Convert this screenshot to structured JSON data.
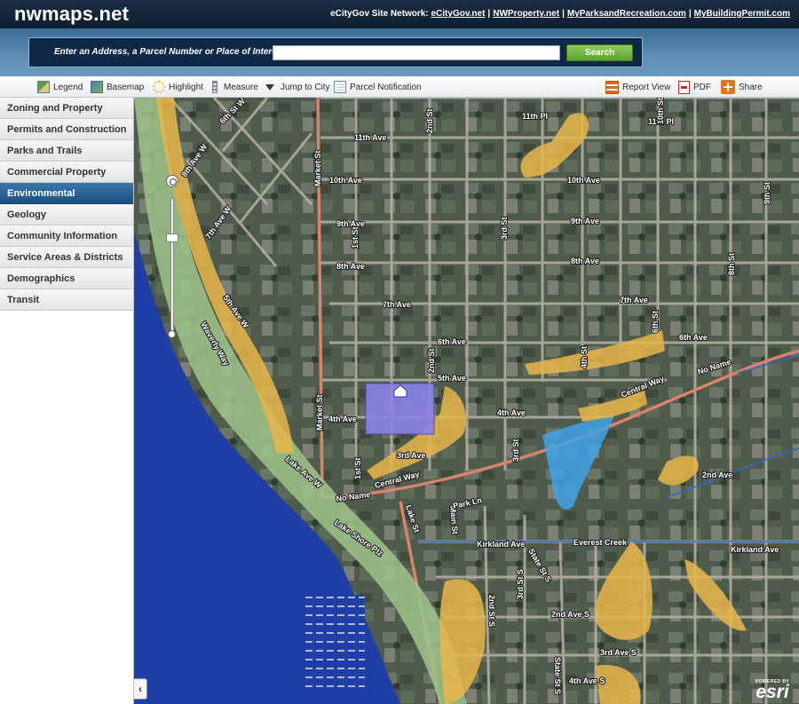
{
  "header": {
    "logo": "nwmaps.net",
    "network_label": "eCityGov Site Network:",
    "links": [
      "eCityGov.net",
      "NWProperty.net",
      "MyParksandRecreation.com",
      "MyBuildingPermit.com"
    ],
    "separator": "|"
  },
  "search": {
    "label": "Enter an Address, a Parcel Number or Place of Interest :",
    "value": "",
    "button": "Search"
  },
  "toolbar": {
    "legend": "Legend",
    "basemap": "Basemap",
    "highlight": "Highlight",
    "measure": "Measure",
    "jump_to_city": "Jump to City",
    "parcel_notification": "Parcel Notification",
    "report_view": "Report View",
    "pdf": "PDF",
    "share": "Share"
  },
  "sidebar": {
    "items": [
      {
        "label": "Zoning and Property",
        "active": false
      },
      {
        "label": "Permits and Construction",
        "active": false
      },
      {
        "label": "Parks and Trails",
        "active": false
      },
      {
        "label": "Commercial Property",
        "active": false
      },
      {
        "label": "Environmental",
        "active": true
      },
      {
        "label": "Geology",
        "active": false
      },
      {
        "label": "Community Information",
        "active": false
      },
      {
        "label": "Service Areas & Districts",
        "active": false
      },
      {
        "label": "Demographics",
        "active": false
      },
      {
        "label": "Transit",
        "active": false
      }
    ]
  },
  "map": {
    "labels": {
      "sixth_st_w": "6th St W",
      "eighth_ave_w": "8th Ave W",
      "seventh_ave_w": "7th Ave W",
      "fifth_ave_w": "5th Ave W",
      "waverly_way": "Waverly Way",
      "market_st": "Market St",
      "eleventh_ave": "11th Ave",
      "tenth_ave": "10th Ave",
      "ninth_ave": "9th Ave",
      "eighth_ave": "8th Ave",
      "seventh_ave": "7th Ave",
      "sixth_ave": "6th Ave",
      "fifth_ave": "5th Ave",
      "fourth_ave": "4th Ave",
      "third_ave": "3rd Ave",
      "first_st": "1st St",
      "second_st": "2nd St",
      "third_st": "3rd St",
      "fourth_st": "4th St",
      "sixth_st": "6th St",
      "eleventh_pl": "11th Pl",
      "tenth_st": "10th St",
      "eighth_st": "8th St",
      "ninth_st": "9th St",
      "central_way": "Central Way",
      "no_name": "No Name",
      "lake_ave_w": "Lake Ave W",
      "lake_st": "Lake St",
      "main_st": "Main St",
      "park_ln": "Park Ln",
      "lake_shore_plz": "Lake Shore Plz",
      "kirkland_ave": "Kirkland Ave",
      "everest_creek": "Everest Creek",
      "state_st_s": "State St S",
      "second_ave_s": "2nd Ave S",
      "third_ave_s": "3rd Ave S",
      "fourth_ave_s": "4th Ave S",
      "second_st_s": "2nd St S",
      "third_st_s": "3rd St S",
      "second_ave": "2nd Ave"
    },
    "zoom_level": 0.72,
    "colors": {
      "water": "#1f3ea6",
      "shoreline_buffer": "#9ec48a",
      "environmental_zone": "#e8b64a",
      "wetland": "#3fa3e8",
      "selected_parcel": "#8b82e6",
      "arterial_road": "#d9826d"
    }
  },
  "esri": {
    "powered_by": "POWERED BY",
    "brand": "esri"
  }
}
